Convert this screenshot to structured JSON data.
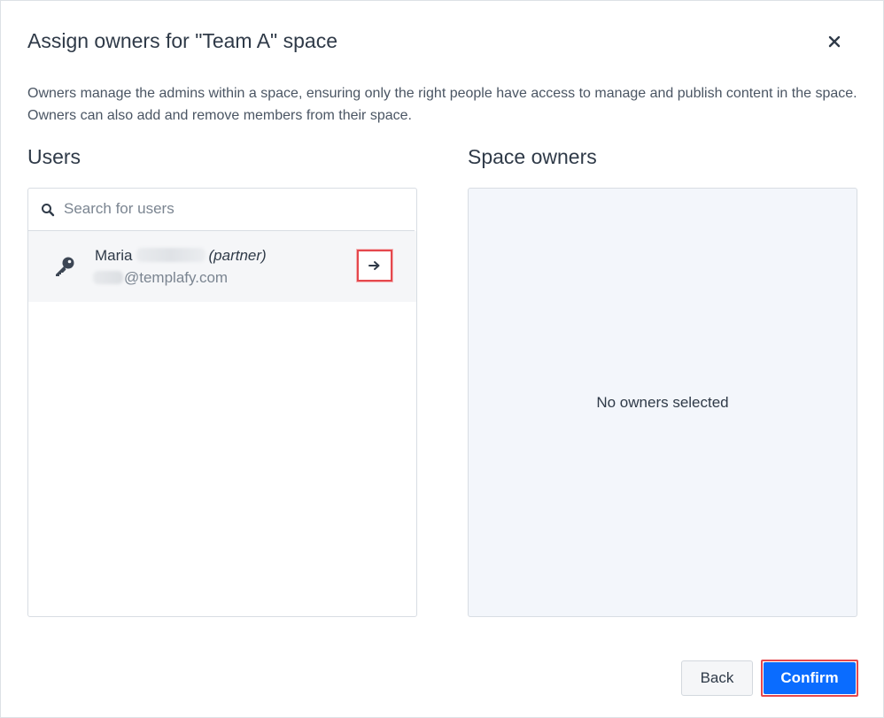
{
  "dialog": {
    "title": "Assign owners for \"Team A\" space",
    "close_icon": "close-icon",
    "description": "Owners manage the admins within a space, ensuring only the right people have access to manage and publish content in the space. Owners can also add and remove members from their space."
  },
  "users": {
    "heading": "Users",
    "search": {
      "placeholder": "Search for users",
      "value": "",
      "icon": "search-icon"
    },
    "list": [
      {
        "first_name": "Maria",
        "tag": "(partner)",
        "email_domain": "@templafy.com",
        "icon": "key-icon",
        "action_icon": "arrow-right-icon"
      }
    ]
  },
  "owners": {
    "heading": "Space owners",
    "empty_text": "No owners selected"
  },
  "footer": {
    "back_label": "Back",
    "confirm_label": "Confirm"
  },
  "colors": {
    "primary": "#0a6cff",
    "highlight": "#e5484d",
    "text": "#2f3a48",
    "owners_panel_bg": "#f3f6fb"
  }
}
